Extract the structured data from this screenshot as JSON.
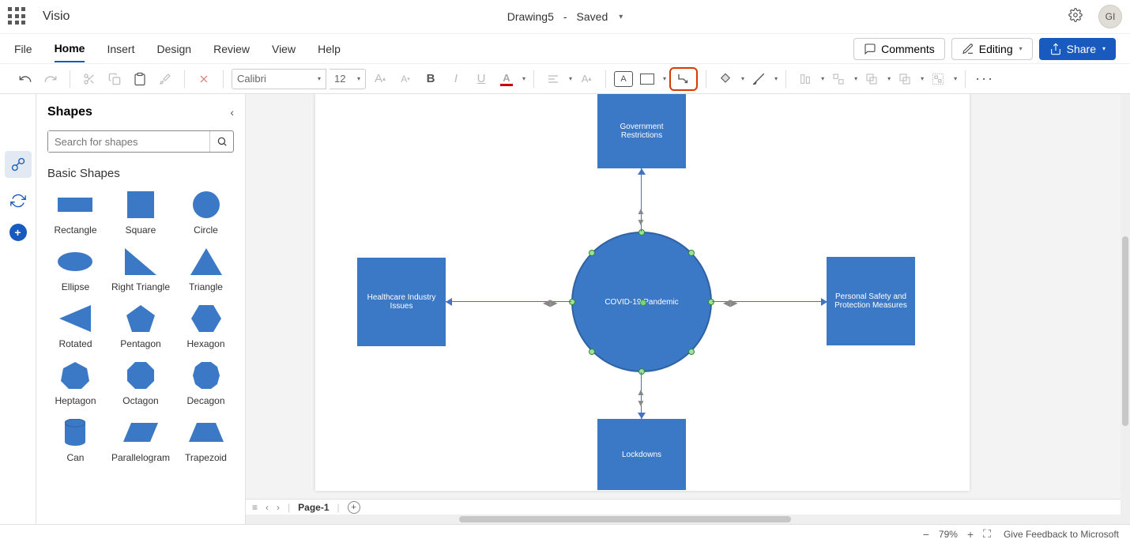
{
  "app": {
    "name": "Visio",
    "user_initials": "GI"
  },
  "document": {
    "name": "Drawing5",
    "status": "Saved"
  },
  "menu_tabs": [
    "File",
    "Home",
    "Insert",
    "Design",
    "Review",
    "View",
    "Help"
  ],
  "active_tab": "Home",
  "top_buttons": {
    "comments": "Comments",
    "editing": "Editing",
    "share": "Share"
  },
  "ribbon": {
    "font_name": "Calibri",
    "font_size": "12"
  },
  "shapes_panel": {
    "title": "Shapes",
    "search_placeholder": "Search for shapes",
    "category": "Basic Shapes",
    "shapes": [
      "Rectangle",
      "Square",
      "Circle",
      "Ellipse",
      "Right Triangle",
      "Triangle",
      "Rotated",
      "Pentagon",
      "Hexagon",
      "Heptagon",
      "Octagon",
      "Decagon",
      "Can",
      "Parallelogram",
      "Trapezoid"
    ]
  },
  "canvas": {
    "center_node": "COVID-19 Pandemic",
    "top_node": "Government Restrictions",
    "bottom_node": "Lockdowns",
    "left_node": "Healthcare Industry Issues",
    "right_node": "Personal Safety and Protection Measures"
  },
  "page_tabs": {
    "current": "Page-1"
  },
  "status": {
    "zoom": "79%",
    "feedback": "Give Feedback to Microsoft"
  }
}
